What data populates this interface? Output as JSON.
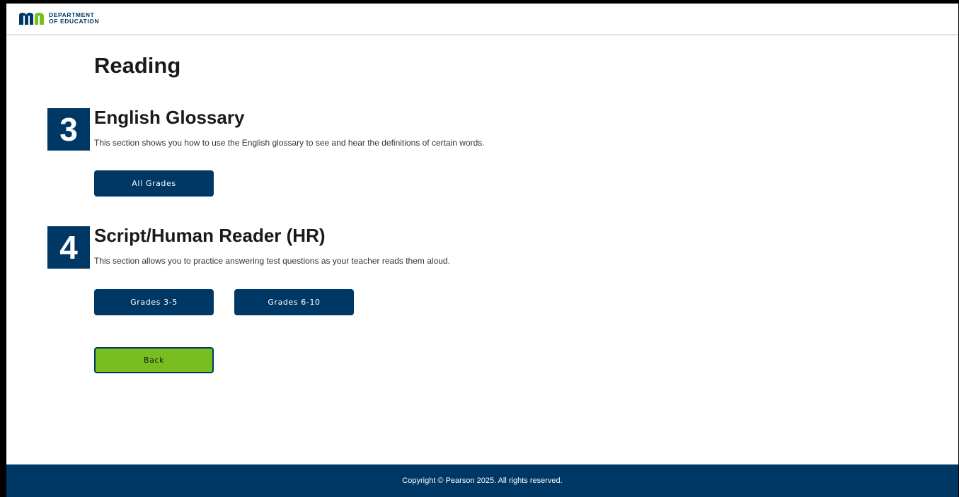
{
  "header": {
    "logo_abbrev": "mn",
    "logo_line1": "DEPARTMENT",
    "logo_line2": "OF EDUCATION",
    "colors": {
      "navy": "#003865",
      "green": "#78be20"
    }
  },
  "main": {
    "title": "Reading",
    "sections": [
      {
        "number": "3",
        "title": "English Glossary",
        "description": "This section shows you how to use the English glossary to see and hear the definitions of certain words.",
        "buttons": [
          "All Grades"
        ]
      },
      {
        "number": "4",
        "title": "Script/Human Reader (HR)",
        "description": "This section allows you to practice answering test questions as your teacher reads them aloud.",
        "buttons": [
          "Grades 3-5",
          "Grades 6-10"
        ]
      }
    ],
    "back_label": "Back"
  },
  "footer": {
    "copyright": "Copyright © Pearson 2025. All rights reserved."
  }
}
